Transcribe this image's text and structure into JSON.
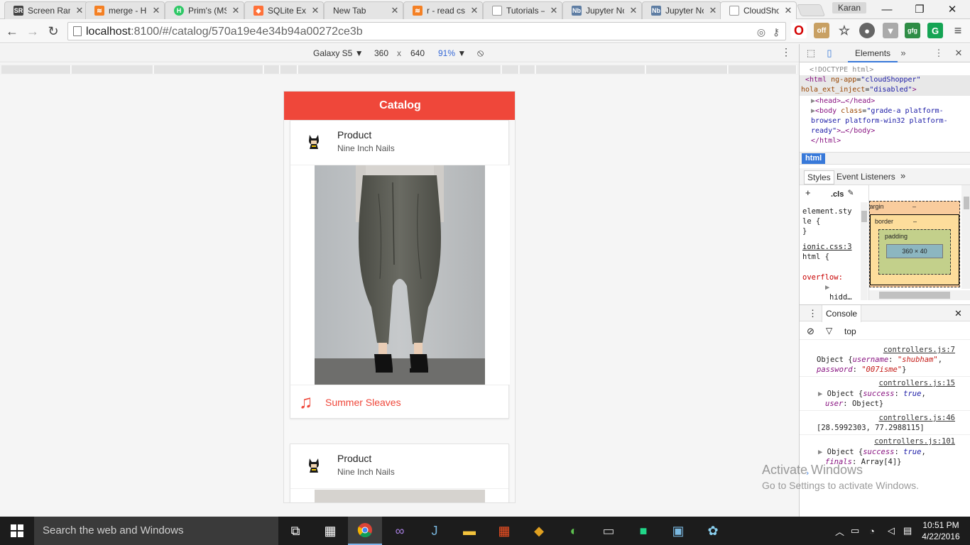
{
  "browser": {
    "tabs": [
      {
        "title": "Screen Ran",
        "favicon": "SR",
        "color": "#444"
      },
      {
        "title": "merge - H",
        "favicon": "≋",
        "color": "#f48024"
      },
      {
        "title": "Prim's (MS",
        "favicon": "H",
        "color": "#2ec866"
      },
      {
        "title": "SQLite Exp",
        "favicon": "◆",
        "color": "#ff7139"
      },
      {
        "title": "New Tab",
        "favicon": "",
        "color": "#e4e4e4"
      },
      {
        "title": "r - read cs",
        "favicon": "≋",
        "color": "#f48024"
      },
      {
        "title": "Tutorials –",
        "favicon": "▢",
        "color": "#999"
      },
      {
        "title": "Jupyter No",
        "favicon": "Nb",
        "color": "#5e7da3"
      },
      {
        "title": "Jupyter No",
        "favicon": "Nb",
        "color": "#5e7da3"
      },
      {
        "title": "CloudShop",
        "favicon": "▢",
        "color": "#999"
      }
    ],
    "profile_name": "Karan",
    "url_host": "localhost",
    "url_path": ":8100/#/catalog/570a19e4e34b94a00272ce3b"
  },
  "device_toolbar": {
    "device": "Galaxy S5",
    "width": "360",
    "times": "x",
    "height": "640",
    "zoom": "91%"
  },
  "app": {
    "header_title": "Catalog",
    "accent_color": "#ef473a",
    "cards": [
      {
        "title": "Product",
        "subtitle": "Nine Inch Nails",
        "footer_label": "Summer Sleaves",
        "avatar_icon": "batman-icon",
        "footer_icon": "music-note-icon"
      },
      {
        "title": "Product",
        "subtitle": "Nine Inch Nails",
        "avatar_icon": "batman-icon"
      }
    ]
  },
  "devtools": {
    "tab_elements": "Elements",
    "dom": {
      "doctype": "<!DOCTYPE html>",
      "html_open": "<html",
      "ng_app_name": "ng-app",
      "ng_app_value": "\"cloudShopper\"",
      "hola_name": "hola_ext_inject",
      "hola_value": "\"disabled\"",
      "gt": ">",
      "head": "<head>…</head>",
      "body_open": "<body",
      "class_name": "class",
      "class_value_1": "\"grade-a platform-",
      "class_value_2": "browser platform-win32 platform-",
      "class_value_3": "ready\"",
      "body_close": ">…</body>",
      "html_close": "</html>"
    },
    "breadcrumb": "html",
    "styles_tab": "Styles",
    "listeners_tab": "Event Listeners",
    "cls": ".cls",
    "styles": {
      "element_style_1": "element.sty",
      "element_style_2": "le {",
      "close": "}",
      "source": "ionic.css:3",
      "html_rule": "html {",
      "prop": "overflow:",
      "value": "hidd…"
    },
    "box_model": {
      "margin": "margin",
      "border": "border",
      "padding": "padding",
      "content": "360 × 40",
      "dash": "–"
    },
    "console_title": "Console",
    "console_context": "top",
    "logs": [
      {
        "source": "controllers.js:7",
        "lines": [
          "Object {username: \"shubham\",",
          "password: \"007isme\"}"
        ]
      },
      {
        "source": "controllers.js:15",
        "lines": [
          "Object {success: true,",
          "user: Object}"
        ]
      },
      {
        "source": "controllers.js:46",
        "lines": [
          "[28.5992303, 77.2988115]"
        ]
      },
      {
        "source": "controllers.js:101",
        "lines": [
          "Object {success: true,",
          "finals: Array[4]}"
        ]
      }
    ]
  },
  "watermark": {
    "line1": "Activate Windows",
    "line2": "Go to Settings to activate Windows."
  },
  "taskbar": {
    "search_placeholder": "Search the web and Windows",
    "time": "10:51 PM",
    "date": "4/22/2016"
  }
}
